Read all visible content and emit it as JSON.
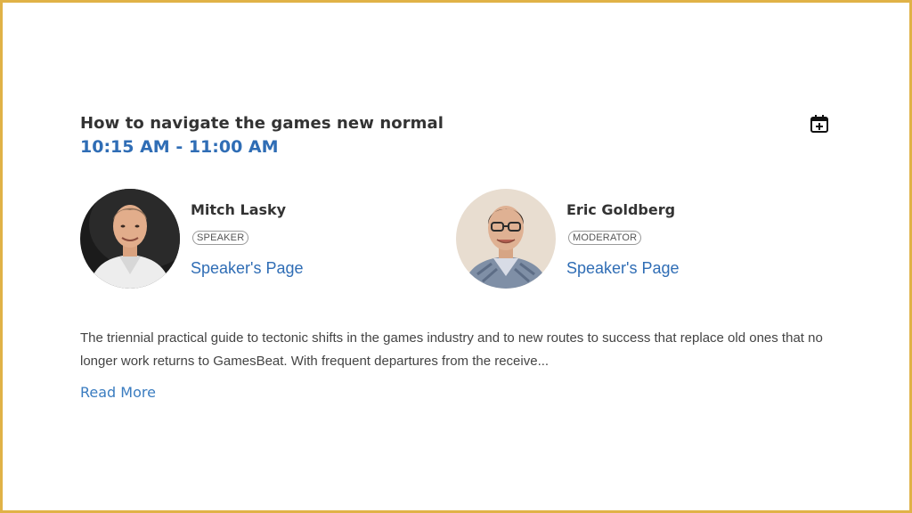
{
  "session": {
    "title": "How to navigate the games new normal",
    "time": "10:15 AM - 11:00 AM",
    "add_to_calendar_icon": "calendar-plus-icon"
  },
  "speakers": [
    {
      "name": "Mitch Lasky",
      "role": "SPEAKER",
      "link_label": "Speaker's Page",
      "avatar": "speaker-photo"
    },
    {
      "name": "Eric Goldberg",
      "role": "MODERATOR",
      "link_label": "Speaker's Page",
      "avatar": "speaker-photo"
    }
  ],
  "description": "The triennial practical guide to tectonic shifts in the games industry and to new routes to success that replace old ones that no longer work returns to GamesBeat. With frequent departures from the receive...",
  "read_more_label": "Read More",
  "colors": {
    "border": "#e0b247",
    "accent": "#2f6db5",
    "title": "#333333"
  }
}
